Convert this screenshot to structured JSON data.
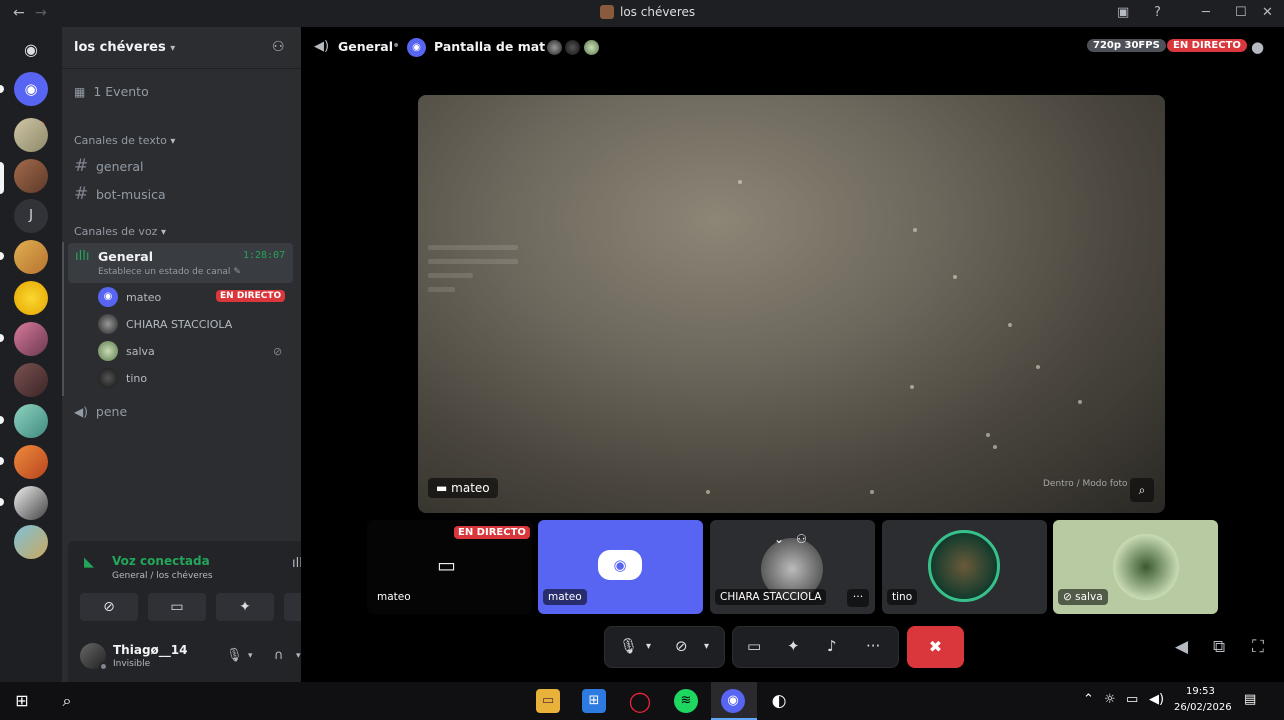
{
  "window": {
    "title": "los chéveres",
    "back_icon": "arrow-left",
    "forward_icon": "arrow-right"
  },
  "sidebar": {
    "server_name": "los chéveres",
    "event_label": "1 Evento",
    "text_category": "Canales de texto",
    "text_channels": [
      "general",
      "bot-musica"
    ],
    "voice_category": "Canales de voz",
    "active_voice": {
      "name": "General",
      "status": "Establece un estado de canal",
      "timer": "1:28:07"
    },
    "voice_users": [
      {
        "name": "mateo",
        "live": "EN DIRECTO"
      },
      {
        "name": "CHIARA STACCIOLA"
      },
      {
        "name": "salva"
      },
      {
        "name": "tino"
      }
    ],
    "other_voice_channel": "pene"
  },
  "voice_panel": {
    "title": "Voz conectada",
    "subtitle": "General / los chéveres"
  },
  "user_panel": {
    "name": "Thiagø__14",
    "status": "Invisible"
  },
  "stage": {
    "channel": "General",
    "screen_title": "Pantalla de mateo",
    "quality": "720p 30FPS",
    "live": "EN DIRECTO",
    "main_video_name": "mateo",
    "focus_hint": "Dentro / Modo foto",
    "tiles": [
      {
        "name": "mateo",
        "live": "EN DIRECTO"
      },
      {
        "name": "mateo"
      },
      {
        "name": "CHIARA STACCIOLA"
      },
      {
        "name": "tino"
      },
      {
        "name": "salva"
      }
    ]
  },
  "taskbar": {
    "time": "19:53",
    "date": "26/02/2026"
  },
  "colors": {
    "blurple": "#5865f2",
    "live_red": "#da373c",
    "online_green": "#23a55a"
  }
}
